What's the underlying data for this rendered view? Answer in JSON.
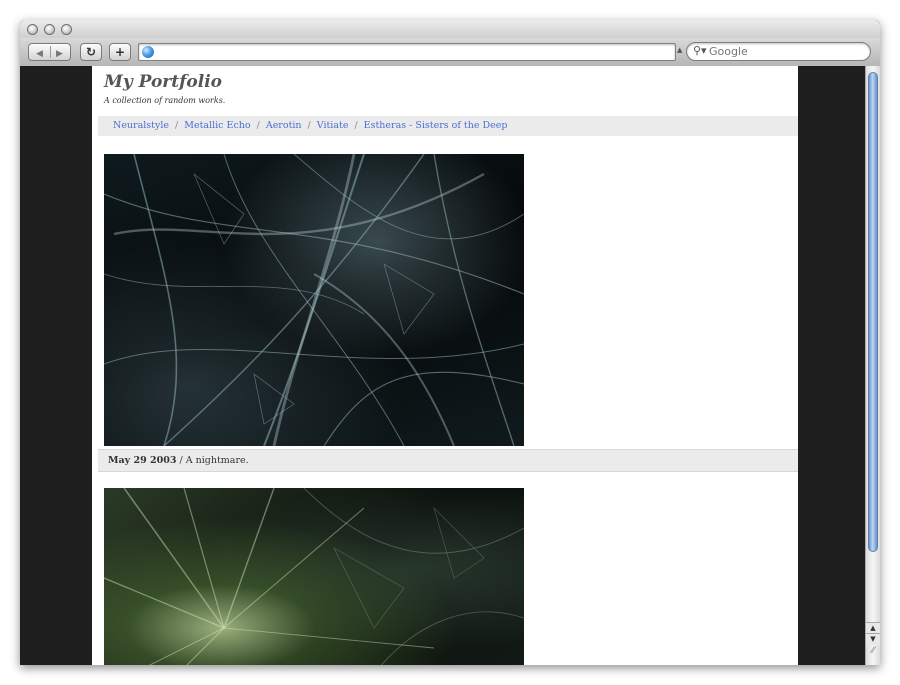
{
  "browser": {
    "nav_back_glyph": "◀",
    "nav_forward_glyph": "▶",
    "reload_glyph": "↻",
    "add_bookmark_glyph": "+",
    "address_value": "",
    "search_placeholder": "Google",
    "search_icon_glyph": "⚲▾",
    "address_toggle_glyph": "▲"
  },
  "page": {
    "title": "My Portfolio",
    "tagline": "A collection of random works.",
    "nav": {
      "links": [
        "Neuralstyle",
        "Metallic Echo",
        "Aerotin",
        "Vitiate",
        "Estheras - Sisters of the Deep"
      ],
      "separator": "/"
    },
    "posts": [
      {
        "date": "May 29 2003",
        "separator": " / ",
        "text": "A nightmare."
      }
    ]
  },
  "scrollbar": {
    "up_glyph": "▲",
    "down_glyph": "▼",
    "grip_glyph": "⁄⁄"
  },
  "colors": {
    "link": "#4b6fd6",
    "page_bg": "#ffffff",
    "outer_bg": "#1e1e1e",
    "bar_bg": "#ebebeb"
  }
}
